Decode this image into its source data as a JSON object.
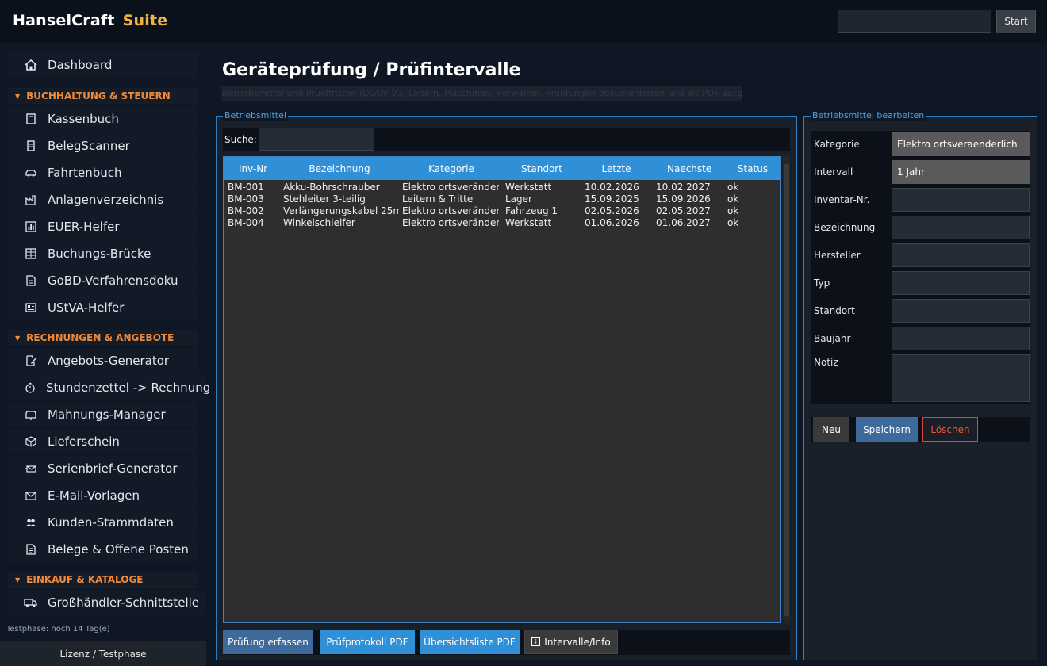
{
  "app": {
    "brand": "HanselCraft",
    "brand_suffix": "Suite",
    "start_label": "Start"
  },
  "sidebar": {
    "dashboard": {
      "label": "Dashboard",
      "icon": "home-icon"
    },
    "sections": [
      {
        "title": "BUCHHALTUNG & STEUERN"
      },
      {
        "title": "RECHNUNGEN & ANGEBOTE"
      },
      {
        "title": "EINKAUF & KATALOGE"
      }
    ],
    "items": [
      {
        "label": "Kassenbuch",
        "icon": "book-icon"
      },
      {
        "label": "BelegScanner",
        "icon": "scanner-icon"
      },
      {
        "label": "Fahrtenbuch",
        "icon": "car-icon"
      },
      {
        "label": "Anlagenverzeichnis",
        "icon": "factory-icon"
      },
      {
        "label": "EUER-Helfer",
        "icon": "chart-icon"
      },
      {
        "label": "Buchungs-Brücke",
        "icon": "ledger-icon"
      },
      {
        "label": "GoBD-Verfahrensdoku",
        "icon": "document-icon"
      },
      {
        "label": "UStVA-Helfer",
        "icon": "calculator-icon"
      },
      {
        "label": "Angebots-Generator",
        "icon": "edit-icon"
      },
      {
        "label": "Stundenzettel -> Rechnung",
        "icon": "stopwatch-icon"
      },
      {
        "label": "Mahnungs-Manager",
        "icon": "mailbox-icon"
      },
      {
        "label": "Lieferschein",
        "icon": "package-icon"
      },
      {
        "label": "Serienbrief-Generator",
        "icon": "envelope-icon"
      },
      {
        "label": "E-Mail-Vorlagen",
        "icon": "mail-icon"
      },
      {
        "label": "Kunden-Stammdaten",
        "icon": "users-icon"
      },
      {
        "label": "Belege & Offene Posten",
        "icon": "receipt-icon"
      },
      {
        "label": "Großhändler-Schnittstelle",
        "icon": "truck-icon"
      }
    ],
    "trial_text": "Testphase: noch 14 Tag(e)",
    "license_label": "Lizenz / Testphase"
  },
  "main": {
    "title": "Geräteprüfung / Prüfintervalle",
    "subtitle": "Betriebsmittel und Prueffristen (DGUV V3, Leitern, Maschinen) verwalten. Pruefungen dokumentieren und als PDF ausgeben.",
    "list_group_title": "Betriebsmittel",
    "search_label": "Suche:",
    "search_value": "",
    "columns": [
      "Inv-Nr",
      "Bezeichnung",
      "Kategorie",
      "Standort",
      "Letzte",
      "Naechste",
      "Status"
    ],
    "rows": [
      [
        "BM-001",
        "Akku-Bohrschrauber",
        "Elektro ortsveränderlich",
        "Werkstatt",
        "10.02.2026",
        "10.02.2027",
        "ok"
      ],
      [
        "BM-003",
        "Stehleiter 3-teilig",
        "Leitern & Tritte",
        "Lager",
        "15.09.2025",
        "15.09.2026",
        "ok"
      ],
      [
        "BM-002",
        "Verlängerungskabel 25m",
        "Elektro ortsveränderlich",
        "Fahrzeug 1",
        "02.05.2026",
        "02.05.2027",
        "ok"
      ],
      [
        "BM-004",
        "Winkelschleifer",
        "Elektro ortsveränderlich",
        "Werkstatt",
        "01.06.2026",
        "01.06.2027",
        "ok"
      ]
    ],
    "buttons": {
      "record": "Prüfung erfassen",
      "protocol_pdf": "Prüfprotokoll PDF",
      "overview_pdf": "Übersichtsliste PDF",
      "info": "Intervalle/Info"
    }
  },
  "editor": {
    "group_title": "Betriebsmittel bearbeiten",
    "fields": {
      "kategorie": {
        "label": "Kategorie",
        "value": "Elektro ortsveraenderlich"
      },
      "intervall": {
        "label": "Intervall",
        "value": "1 Jahr"
      },
      "inventar": {
        "label": "Inventar-Nr.",
        "value": ""
      },
      "bezeichnung": {
        "label": "Bezeichnung",
        "value": ""
      },
      "hersteller": {
        "label": "Hersteller",
        "value": ""
      },
      "typ": {
        "label": "Typ",
        "value": ""
      },
      "standort": {
        "label": "Standort",
        "value": ""
      },
      "baujahr": {
        "label": "Baujahr",
        "value": ""
      },
      "notiz": {
        "label": "Notiz",
        "value": ""
      }
    },
    "buttons": {
      "new": "Neu",
      "save": "Speichern",
      "delete": "Löschen"
    }
  }
}
